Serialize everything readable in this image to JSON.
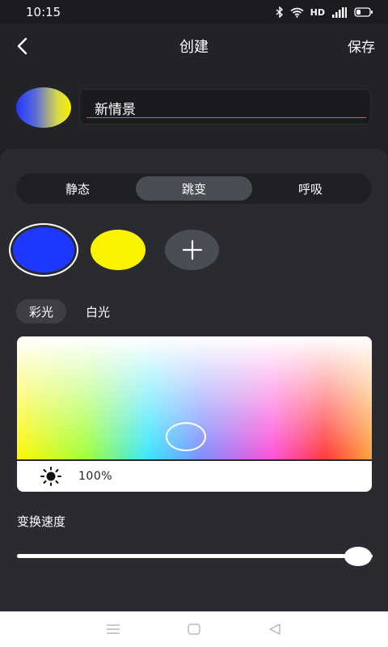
{
  "status_bar": {
    "time": "10:15",
    "network_label": "HD",
    "icons": [
      "bluetooth-icon",
      "wifi-icon",
      "signal-icon",
      "battery-icon"
    ]
  },
  "header": {
    "title": "创建",
    "save_label": "保存",
    "back_icon": "chevron-left-icon"
  },
  "scene": {
    "name_value": "新情景",
    "preview_colors": [
      "#2436ff",
      "#f4f000"
    ],
    "underline_color": "#e25a2c"
  },
  "mode_tabs": [
    {
      "label": "静态",
      "active": false
    },
    {
      "label": "跳变",
      "active": true
    },
    {
      "label": "呼吸",
      "active": false
    }
  ],
  "color_swatches": [
    {
      "color": "#1f38ff",
      "selected": true
    },
    {
      "color": "#fbf300",
      "selected": false
    }
  ],
  "add_color_icon": "plus-icon",
  "light_tabs": [
    {
      "label": "彩光",
      "active": true
    },
    {
      "label": "白光",
      "active": false
    }
  ],
  "color_picker": {
    "brightness_icon": "sun-icon",
    "brightness_value": "100%"
  },
  "speed": {
    "label": "变换速度",
    "value_fraction": 0.96
  },
  "nav_bar": {
    "icons": [
      "menu-icon",
      "home-square-icon",
      "back-triangle-icon"
    ]
  }
}
